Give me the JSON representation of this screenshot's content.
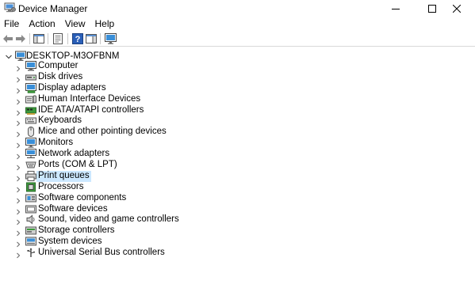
{
  "window": {
    "title": "Device Manager"
  },
  "menu": {
    "items": [
      "File",
      "Action",
      "View",
      "Help"
    ]
  },
  "toolbar": {
    "buttons": [
      {
        "icon": "back-arrow-icon"
      },
      {
        "icon": "forward-arrow-icon"
      },
      {
        "icon": "show-hide-console-tree-icon"
      },
      {
        "icon": "properties-icon"
      },
      {
        "icon": "help-icon"
      },
      {
        "icon": "show-hide-action-pane-icon"
      },
      {
        "icon": "monitor-icon"
      }
    ]
  },
  "tree": {
    "root": {
      "label": "DESKTOP-M3OFBNM",
      "expanded": true
    },
    "selected_index": 10,
    "categories": [
      {
        "label": "Computer",
        "icon": "computer-icon"
      },
      {
        "label": "Disk drives",
        "icon": "disk-drive-icon"
      },
      {
        "label": "Display adapters",
        "icon": "display-adapter-icon"
      },
      {
        "label": "Human Interface Devices",
        "icon": "hid-icon"
      },
      {
        "label": "IDE ATA/ATAPI controllers",
        "icon": "ide-controller-icon"
      },
      {
        "label": "Keyboards",
        "icon": "keyboard-icon"
      },
      {
        "label": "Mice and other pointing devices",
        "icon": "mouse-icon"
      },
      {
        "label": "Monitors",
        "icon": "monitor-icon"
      },
      {
        "label": "Network adapters",
        "icon": "network-adapter-icon"
      },
      {
        "label": "Ports (COM & LPT)",
        "icon": "port-icon"
      },
      {
        "label": "Print queues",
        "icon": "printer-icon"
      },
      {
        "label": "Processors",
        "icon": "processor-icon"
      },
      {
        "label": "Software components",
        "icon": "software-component-icon"
      },
      {
        "label": "Software devices",
        "icon": "software-device-icon"
      },
      {
        "label": "Sound, video and game controllers",
        "icon": "speaker-icon"
      },
      {
        "label": "Storage controllers",
        "icon": "storage-controller-icon"
      },
      {
        "label": "System devices",
        "icon": "system-device-icon"
      },
      {
        "label": "Universal Serial Bus controllers",
        "icon": "usb-icon"
      }
    ]
  },
  "colors": {
    "selection": "#cce8ff",
    "icon_blue": "#1e78c8",
    "icon_green": "#3c9a3c",
    "chevron": "#6e6e6e"
  }
}
